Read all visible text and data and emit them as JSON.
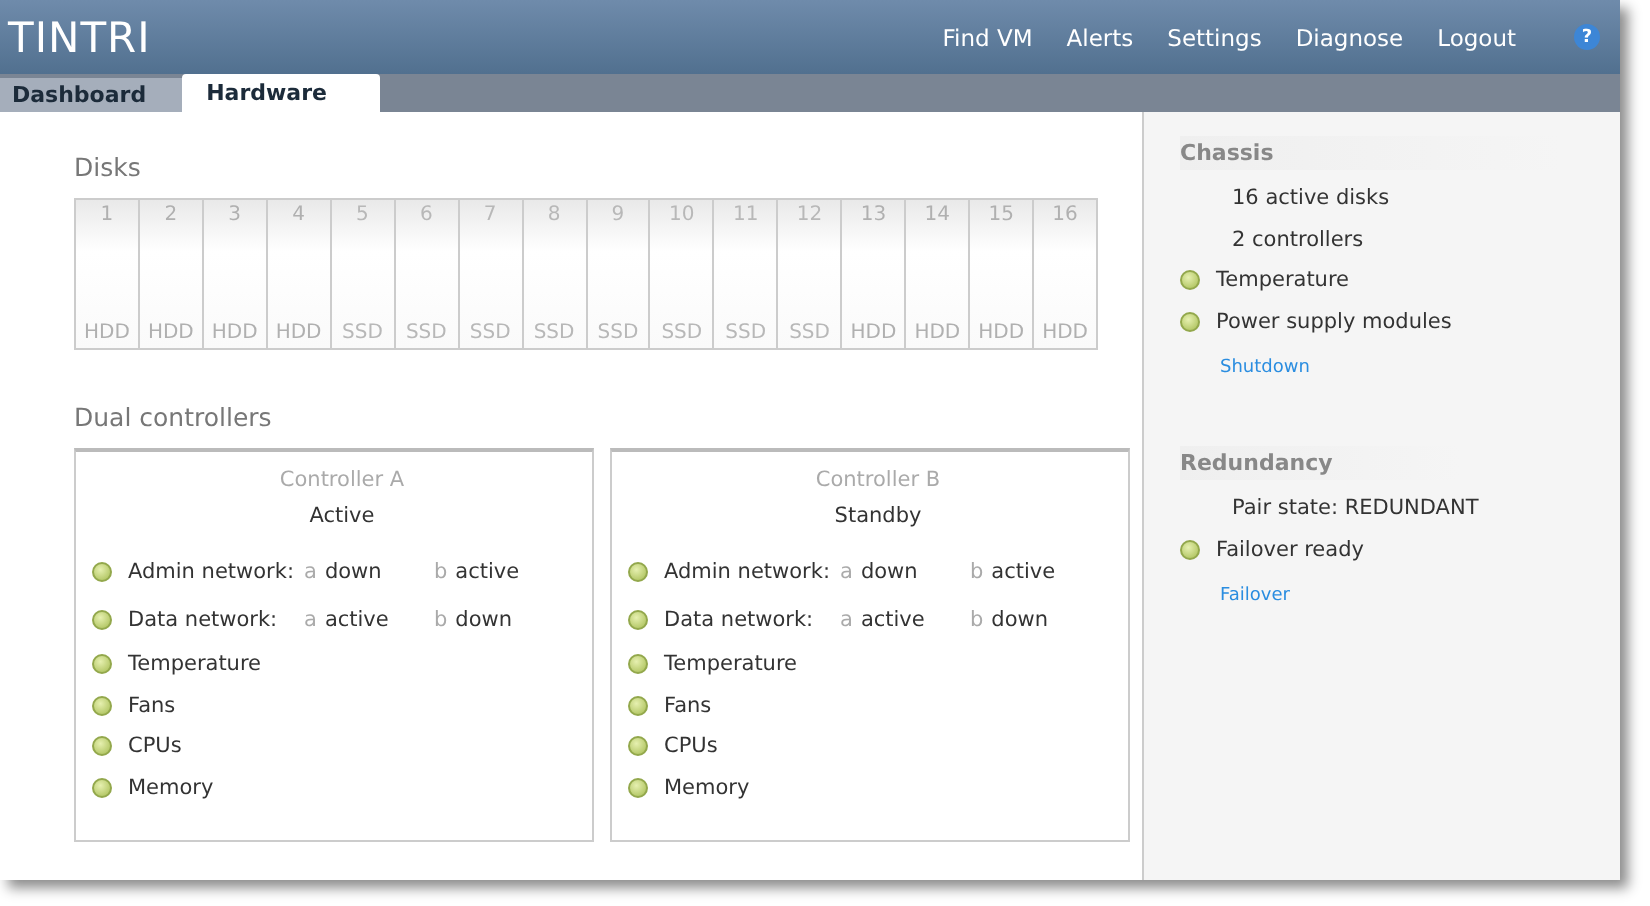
{
  "header": {
    "logo": "TINTRI",
    "nav": [
      "Find VM",
      "Alerts",
      "Settings",
      "Diagnose",
      "Logout"
    ],
    "help": "?"
  },
  "tabs": [
    {
      "label": "Dashboard",
      "selected": false
    },
    {
      "label": "Hardware",
      "selected": true
    }
  ],
  "disks": {
    "title": "Disks",
    "items": [
      {
        "number": "1",
        "type": "HDD"
      },
      {
        "number": "2",
        "type": "HDD"
      },
      {
        "number": "3",
        "type": "HDD"
      },
      {
        "number": "4",
        "type": "HDD"
      },
      {
        "number": "5",
        "type": "SSD"
      },
      {
        "number": "6",
        "type": "SSD"
      },
      {
        "number": "7",
        "type": "SSD"
      },
      {
        "number": "8",
        "type": "SSD"
      },
      {
        "number": "9",
        "type": "SSD"
      },
      {
        "number": "10",
        "type": "SSD"
      },
      {
        "number": "11",
        "type": "SSD"
      },
      {
        "number": "12",
        "type": "SSD"
      },
      {
        "number": "13",
        "type": "HDD"
      },
      {
        "number": "14",
        "type": "HDD"
      },
      {
        "number": "15",
        "type": "HDD"
      },
      {
        "number": "16",
        "type": "HDD"
      }
    ]
  },
  "controllers": {
    "title": "Dual controllers",
    "items": [
      {
        "name": "Controller A",
        "state": "Active",
        "rows": [
          {
            "label": "Admin network:",
            "ok": true,
            "ports": [
              {
                "port": "a",
                "state": "down"
              },
              {
                "port": "b",
                "state": "active"
              }
            ]
          },
          {
            "label": "Data network:",
            "ok": true,
            "ports": [
              {
                "port": "a",
                "state": "active"
              },
              {
                "port": "b",
                "state": "down"
              }
            ]
          },
          {
            "label": "Temperature",
            "ok": true
          },
          {
            "label": "Fans",
            "ok": true
          },
          {
            "label": "CPUs",
            "ok": true
          },
          {
            "label": "Memory",
            "ok": true
          }
        ]
      },
      {
        "name": "Controller B",
        "state": "Standby",
        "rows": [
          {
            "label": "Admin network:",
            "ok": true,
            "ports": [
              {
                "port": "a",
                "state": "down"
              },
              {
                "port": "b",
                "state": "active"
              }
            ]
          },
          {
            "label": "Data network:",
            "ok": true,
            "ports": [
              {
                "port": "a",
                "state": "active"
              },
              {
                "port": "b",
                "state": "down"
              }
            ]
          },
          {
            "label": "Temperature",
            "ok": true
          },
          {
            "label": "Fans",
            "ok": true
          },
          {
            "label": "CPUs",
            "ok": true
          },
          {
            "label": "Memory",
            "ok": true
          }
        ]
      }
    ]
  },
  "sidebar": [
    {
      "title": "Chassis",
      "items": [
        {
          "label": "16 active disks"
        },
        {
          "label": "2 controllers"
        },
        {
          "label": "Temperature",
          "ok": true
        },
        {
          "label": "Power supply modules",
          "ok": true
        }
      ],
      "link": "Shutdown"
    },
    {
      "title": "Redundancy",
      "items": [
        {
          "label": "Pair state: REDUNDANT"
        },
        {
          "label": "Failover ready",
          "ok": true
        }
      ],
      "link": "Failover"
    }
  ]
}
